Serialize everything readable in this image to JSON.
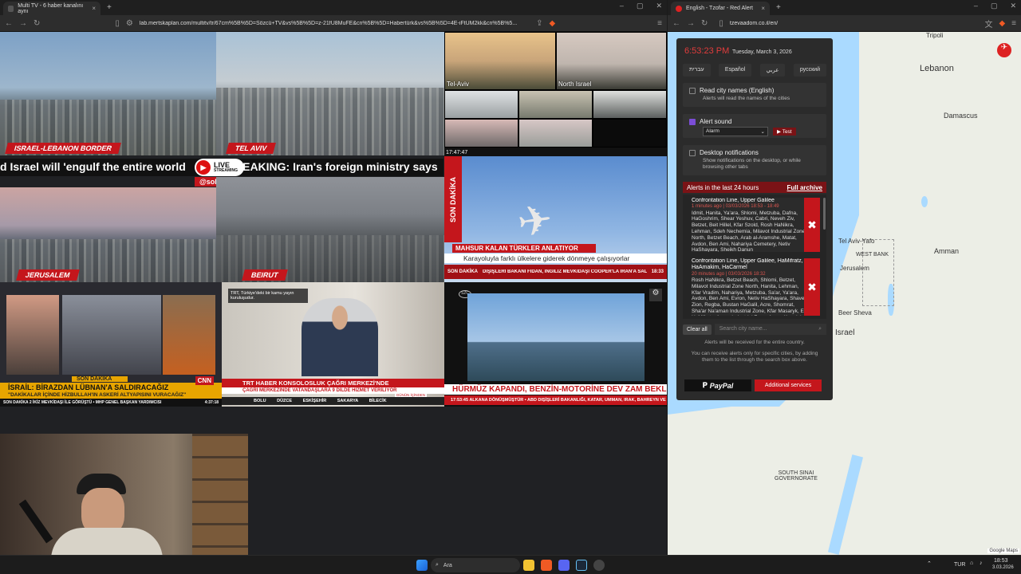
{
  "left_browser": {
    "tab_title": "Multi TV - 6 haber kanalını aynı",
    "url": "lab.mertskaplan.com/multitv/tr/67cm%5B%5D=Sözcü+TV&vs%5B%5D=z-21fU8MuFE&cn%5B%5D=Habertürk&vs%5B%5D=4E-iFtUM2kk&cn%5B%5...",
    "new_tab": "+",
    "close": "×"
  },
  "right_browser": {
    "tab_title": "English - Tzofar - Red Alert",
    "url": "tzevaadom.co.il/en/",
    "new_tab": "+",
    "close": "×"
  },
  "video_grid": {
    "labels": {
      "israel_lebanon": "ISRAEL-LEBANON BORDER",
      "tel_aviv": "TEL AVIV",
      "jerusalem": "JERUSALEM",
      "beirut": "BEIRUT"
    },
    "ticker": "d Israel will 'engulf the entire world",
    "ticker2": "REAKING: Iran's foreign ministry says",
    "live_label": "LIVE",
    "live_sub": "STREAMING",
    "handle": "@sokakkedisitv",
    "cams": {
      "tel_aviv": "Tel-Aviv",
      "north_israel": "North Israel",
      "timestamp": "17:47:47"
    },
    "son_dakika": "SON DAKİKA",
    "plane_headline": "MAHSUR KALAN TÜRKLER ANLATIYOR",
    "plane_sub": "Karayoluyla farklı ülkelere giderek dönmeye çalışıyorlar",
    "plane_ticker_label": "SON DAKİKA",
    "plane_ticker": "DIŞİŞLERİ BAKANI FİDAN, İNGİLİZ MEVKİDAŞI COOPER'LA İRAN'A SALDIRILARI VE DİPLOMATİK GİRİŞİMLERİ KONUŞTU",
    "plane_time": "18:33",
    "cnn_son_dakika": "SON DAKİKA",
    "cnn_headline": "İSRAİL: BİRAZDAN LÜBNAN'A SALDIRACAĞIZ",
    "cnn_sub": "\"DAKİKALAR İÇİNDE HİZBULLAH'IN ASKERİ ALTYAPISINI VURACAĞIZ\"",
    "cnn_ticker": "SON DAKİKA  2 İKİZ MEVKİDAŞI İLE GÖRÜŞTÜ • MHP GENEL BAŞKAN YARDIMCISI",
    "cnn_time": "4:37:18",
    "trt_caption": "TRT, Türkiye'deki bir kamu yayın kuruluşudur.",
    "trt_headline": "TRT HABER KONSOLOSLUK ÇAĞRI MERKEZİ'NDE",
    "trt_sub": "ÇAĞRI MERKEZİNDE VATANDAŞLARA 9 DİLDE HİZMET VERİLİYOR",
    "trt_ticker": "BOLU  DÜZCE  ESKİŞEHİR  SAKARYA  BİLECİK",
    "trt_badge": "GÜNÜN İÇİNDEN",
    "sozcu_headline": "HÜRMÜZ KAPANDI, BENZİN-MOTORİNE DEV ZAM BEKLENİYOR",
    "sozcu_ticker": "17:53:45  ALKANA DÖNÜŞMÜŞTÜR • ABD DIŞİŞLERİ BAKANLIĞI, KATAR, UMMAN, IRAK, BAHREYN VE İSRA"
  },
  "alert_panel": {
    "time": "6:53:23 PM",
    "date": "Tuesday, March 3, 2026",
    "languages": [
      "עברית",
      "Español",
      "عربي",
      "русский"
    ],
    "read_names": {
      "title": "Read city names (English)",
      "desc": "Alerts will read the names of the cities",
      "checked": false
    },
    "alert_sound": {
      "title": "Alert sound",
      "select": "Alarm",
      "test": "Test",
      "checked": true
    },
    "desktop": {
      "title": "Desktop notifications",
      "desc": "Show notifications on the desktop, or while browsing other tabs",
      "checked": false
    },
    "alerts_header": "Alerts in the last 24 hours",
    "archive": "Full archive",
    "alerts": [
      {
        "title": "Confrontation Line, Upper Galilee",
        "time": "1 minutes ago | 03/03/2026 18:53 - 18:49",
        "cities": "Idmit, Hanita, Ya'ara, Shlomi, Metzuba, Dafna, HaGoshrim, Shear Yeshuv, Cabri, Neveh Ziv, Betzet, Beit Hillel, Kfar Szold, Rosh HaNikra, Lehman, Sdeh Nechemia, Milavot Industrial Zone North, Betzet Beach, Arab al-Aramshe, Matat, Avdon, Ben Ami, Nahariya Cemetery, Netiv HaShayara, Sheikh Danun"
      },
      {
        "title": "Confrontation Line, Upper Galilee, HaMifratz, HaAmakim, HaCarmel",
        "time": "20 minutes ago | 03/03/2026 18:32",
        "cities": "Rosh HaNikra, Betzet Beach, Shlomi, Betzet, Milavot Industrial Zone North, Hanita, Lehman, Kfar Vradim, Nahariya, Metzuba, Sa'ar, Ya'ara, Avdon, Ben Ami, Evron, Netiv HaShayara, Shavei Zion, Regba, Bustan HaGalil, Acre, Shomrat, Sha'ar Na'aman Industrial Zone, Kfar Masaryk, Ein HaMifratz, Acre - Industrial Zone, Acre - Karmiel, Kfar Yasif"
      }
    ],
    "clear_all": "Clear all",
    "search_placeholder": "Search city name...",
    "entire_country": "Alerts will be received for the entire country.",
    "hint": "You can receive alerts only for specific cities, by adding them to the list through the search box above.",
    "paypal": "PayPal",
    "additional": "Additional services"
  },
  "map": {
    "labels": [
      "Lebanon",
      "Damascus",
      "Tel Aviv-Yafo",
      "WEST BANK",
      "Jerusalem",
      "Amman",
      "Beer Sheva",
      "Israel",
      "SOUTH SINAI GOVERNORATE",
      "Tripoli",
      "Google Maps"
    ]
  },
  "taskbar": {
    "search": "Ara",
    "lang": "TUR",
    "time": "18:53",
    "date": "3.03.2026"
  },
  "colors": {
    "accent": "#c4161c",
    "panel": "#2b2b2b",
    "map": "#eaeae4"
  }
}
